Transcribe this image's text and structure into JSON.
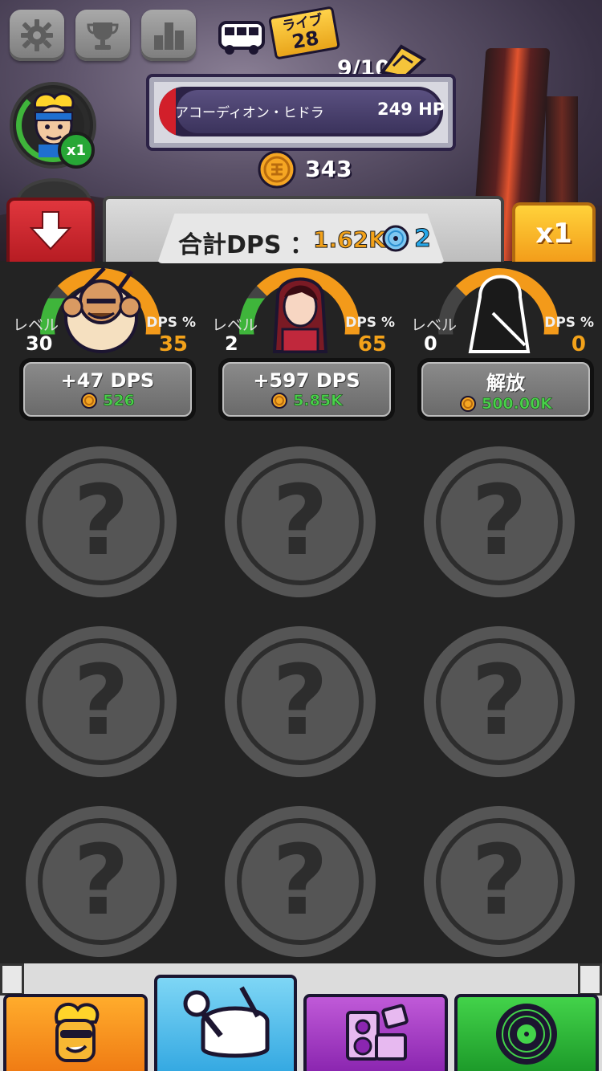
{
  "top": {
    "live_label": "ライブ",
    "live_number": "28",
    "stage_progress": "9/10",
    "boss_name": "アコーディオン・ヒドラ",
    "boss_hp": "249 HP",
    "boss_hp_fraction": 0.06,
    "coins": "343",
    "player_multiplier": "x1"
  },
  "dps_panel": {
    "label": "合計DPS ：",
    "value": "1.62K",
    "discs": "2"
  },
  "speed_button": "x1",
  "heroes": [
    {
      "level_label": "レベル",
      "level": "30",
      "dps_label": "DPS %",
      "dps_pct": "35",
      "buy_title": "+47 DPS",
      "cost": "526"
    },
    {
      "level_label": "レベル",
      "level": "2",
      "dps_label": "DPS %",
      "dps_pct": "65",
      "buy_title": "+597 DPS",
      "cost": "5.85K"
    },
    {
      "level_label": "レベル",
      "level": "0",
      "dps_label": "DPS %",
      "dps_pct": "0",
      "buy_title": "解放",
      "cost": "500.00K"
    }
  ],
  "locked_symbol": "?",
  "colors": {
    "accent_orange": "#f39a1a",
    "hp_red": "#d21f2a",
    "cost_green": "#49d14a",
    "disc_blue": "#27a7e8"
  },
  "icons": {
    "top_buttons": [
      "gear-icon",
      "trophy-icon",
      "leaderboard-icon"
    ],
    "tabs": [
      "singer-icon",
      "drum-kit-icon",
      "speaker-amp-icon",
      "vinyl-record-icon"
    ]
  }
}
